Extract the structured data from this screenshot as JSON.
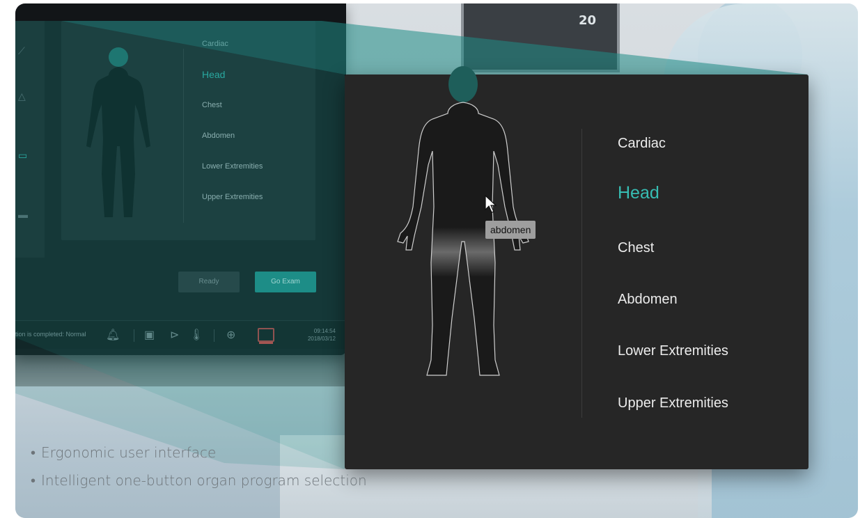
{
  "colors": {
    "accent": "#37bdb3",
    "panel": "#262626",
    "text": "#ececec",
    "tooltip_bg": "#9e9e9e"
  },
  "monitor_bg": {
    "reading": "20"
  },
  "device": {
    "menu_items": [
      {
        "label": "Cardiac",
        "active": false
      },
      {
        "label": "Head",
        "active": true
      },
      {
        "label": "Chest",
        "active": false
      },
      {
        "label": "Abdomen",
        "active": false
      },
      {
        "label": "Lower Extremities",
        "active": false
      },
      {
        "label": "Upper Extremities",
        "active": false
      }
    ],
    "ready_label": "Ready",
    "go_exam_label": "Go Exam",
    "status_text": "tion is completed: Normal",
    "time": "09:14:54",
    "date": "2018/03/12"
  },
  "popup": {
    "menu_items": [
      {
        "label": "Cardiac",
        "active": false
      },
      {
        "label": "Head",
        "active": true
      },
      {
        "label": "Chest",
        "active": false
      },
      {
        "label": "Abdomen",
        "active": false
      },
      {
        "label": "Lower Extremities",
        "active": false
      },
      {
        "label": "Upper Extremities",
        "active": false
      }
    ],
    "tooltip": "abdomen",
    "hover_region": "abdomen"
  },
  "captions": [
    "Ergonomic user interface",
    "Intelligent one-button organ program selection"
  ]
}
